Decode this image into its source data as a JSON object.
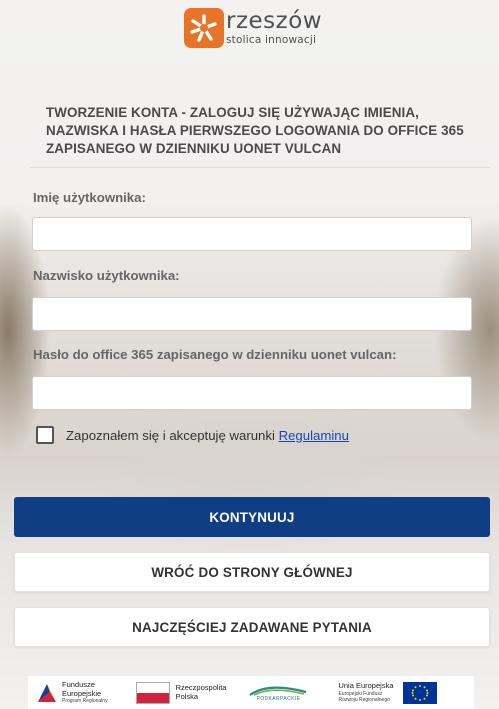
{
  "brand": {
    "name": "rzeszów",
    "tagline": "stolica innowacji",
    "color": "#e8742a"
  },
  "heading": "TWORZENIE KONTA - ZALOGUJ SIĘ UŻYWAJĄC IMIENIA, NAZWISKA I HASŁA PIERWSZEGO LOGOWANIA DO OFFICE 365 ZAPISANEGO W DZIENNIKU UONET VULCAN",
  "form": {
    "first_name_label": "Imię użytkownika:",
    "first_name_value": "",
    "last_name_label": "Nazwisko użytkownika:",
    "last_name_value": "",
    "password_label": "Hasło do office 365 zapisanego w dzienniku uonet vulcan:",
    "password_value": "",
    "consent_text": "Zapoznałem się i akceptuję warunki ",
    "consent_link": "Regulaminu",
    "consent_checked": false
  },
  "buttons": {
    "continue": "KONTYNUUJ",
    "back": "WRÓĆ DO STRONY GŁÓWNEJ",
    "faq": "NAJCZĘŚCIEJ ZADAWANE PYTANIA"
  },
  "colors": {
    "primary": "#0f3e85",
    "link": "#1a46b4"
  },
  "funding": {
    "fe_title_1": "Fundusze",
    "fe_title_2": "Europejskie",
    "fe_sub": "Program Regionalny",
    "rp_1": "Rzeczpospolita",
    "rp_2": "Polska",
    "pk": "PODKARPACKIE",
    "ue_1": "Unia Europejska",
    "ue_2": "Europejski Fundusz",
    "ue_3": "Rozwoju Regionalnego"
  }
}
